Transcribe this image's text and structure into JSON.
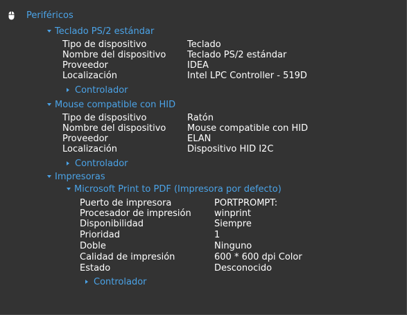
{
  "root": {
    "label": "Periféricos",
    "icon": "mouse-icon",
    "accent": "#4ba3e7"
  },
  "keyboard": {
    "title": "Teclado PS/2 estándar",
    "props": [
      {
        "label": "Tipo de dispositivo",
        "value": "Teclado"
      },
      {
        "label": "Nombre del dispositivo",
        "value": "Teclado PS/2 estándar"
      },
      {
        "label": "Proveedor",
        "value": "IDEA"
      },
      {
        "label": "Localización",
        "value": "Intel LPC Controller - 519D"
      }
    ],
    "driver": "Controlador"
  },
  "mouse": {
    "title": "Mouse compatible con HID",
    "props": [
      {
        "label": "Tipo de dispositivo",
        "value": "Ratón"
      },
      {
        "label": "Nombre del dispositivo",
        "value": "Mouse compatible con HID"
      },
      {
        "label": "Proveedor",
        "value": "ELAN"
      },
      {
        "label": "Localización",
        "value": "Dispositivo HID I2C"
      }
    ],
    "driver": "Controlador"
  },
  "printers": {
    "title": "Impresoras",
    "printer": {
      "title": "Microsoft Print to PDF (Impresora por defecto)",
      "props": [
        {
          "label": "Puerto de impresora",
          "value": "PORTPROMPT:"
        },
        {
          "label": "Procesador de impresión",
          "value": "winprint"
        },
        {
          "label": "Disponibilidad",
          "value": "Siempre"
        },
        {
          "label": "Prioridad",
          "value": "1"
        },
        {
          "label": "Doble",
          "value": "Ninguno"
        },
        {
          "label": "Calidad de impresión",
          "value": "600 * 600 dpi Color"
        },
        {
          "label": "Estado",
          "value": "Desconocido"
        }
      ],
      "driver": "Controlador"
    }
  }
}
